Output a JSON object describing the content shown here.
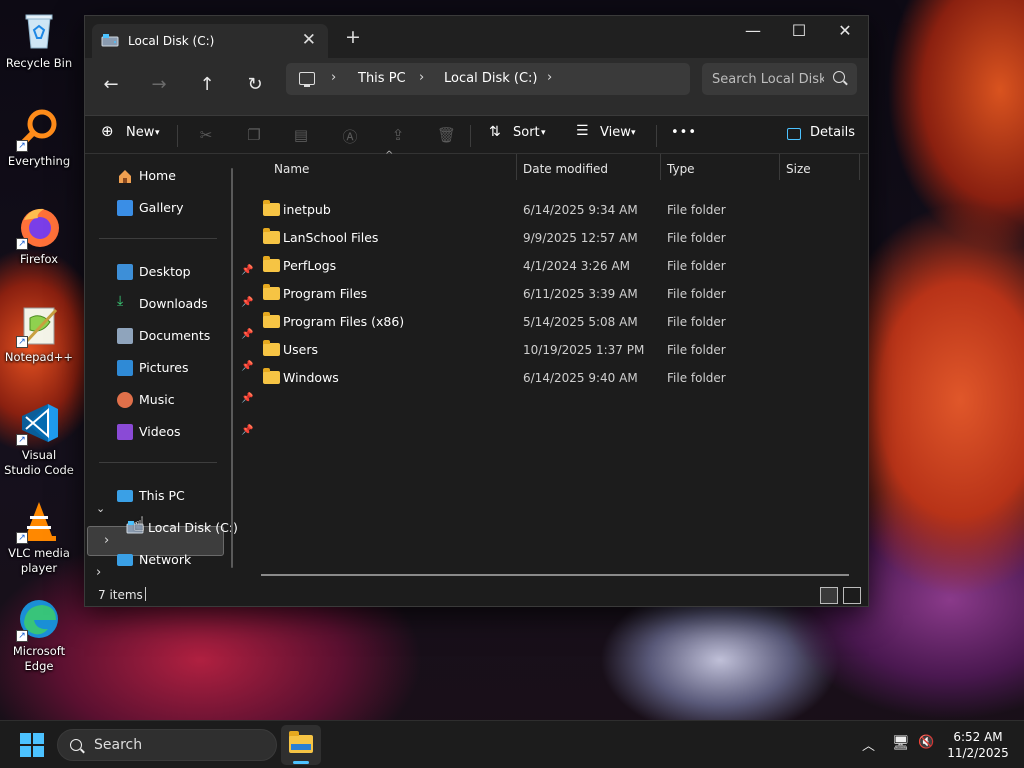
{
  "desktop": {
    "icons": [
      {
        "label": "Recycle Bin"
      },
      {
        "label": "Everything"
      },
      {
        "label": "Firefox"
      },
      {
        "label": "Notepad++"
      },
      {
        "label": "Visual Studio Code"
      },
      {
        "label": "VLC media player"
      },
      {
        "label": "Microsoft Edge"
      }
    ]
  },
  "window": {
    "tab_title": "Local Disk (C:)",
    "new_tab": "+",
    "close_tab": "✕",
    "minimize": "—",
    "maximize": "☐",
    "close": "✕"
  },
  "navbar": {
    "back": "←",
    "forward": "→",
    "up": "↑",
    "refresh": "↻",
    "breadcrumb": [
      "This PC",
      "Local Disk (C:)"
    ],
    "search_placeholder": "Search Local Disk (C:)"
  },
  "toolbar": {
    "new_label": "New",
    "sort_label": "Sort",
    "view_label": "View",
    "more_label": "•••",
    "details_label": "Details"
  },
  "navpane": {
    "home": "Home",
    "gallery": "Gallery",
    "quick_access": [
      {
        "label": "Desktop"
      },
      {
        "label": "Downloads"
      },
      {
        "label": "Documents"
      },
      {
        "label": "Pictures"
      },
      {
        "label": "Music"
      },
      {
        "label": "Videos"
      }
    ],
    "this_pc": "This PC",
    "local_disk": "Local Disk (C:)",
    "network": "Network"
  },
  "filelist": {
    "columns": {
      "name": "Name",
      "date": "Date modified",
      "type": "Type",
      "size": "Size"
    },
    "rows": [
      {
        "name": "inetpub",
        "date": "6/14/2025 9:34 AM",
        "type": "File folder"
      },
      {
        "name": "LanSchool Files",
        "date": "9/9/2025 12:57 AM",
        "type": "File folder"
      },
      {
        "name": "PerfLogs",
        "date": "4/1/2024 3:26 AM",
        "type": "File folder"
      },
      {
        "name": "Program Files",
        "date": "6/11/2025 3:39 AM",
        "type": "File folder"
      },
      {
        "name": "Program Files (x86)",
        "date": "5/14/2025 5:08 AM",
        "type": "File folder"
      },
      {
        "name": "Users",
        "date": "10/19/2025 1:37 PM",
        "type": "File folder"
      },
      {
        "name": "Windows",
        "date": "6/14/2025 9:40 AM",
        "type": "File folder"
      }
    ]
  },
  "status": {
    "item_count": "7 items"
  },
  "taskbar": {
    "search_label": "Search",
    "time": "6:52 AM",
    "date": "11/2/2025"
  },
  "colors": {
    "accent": "#4cc2ff",
    "folder": "#f6c444",
    "window_bg": "#1c1c1c"
  }
}
